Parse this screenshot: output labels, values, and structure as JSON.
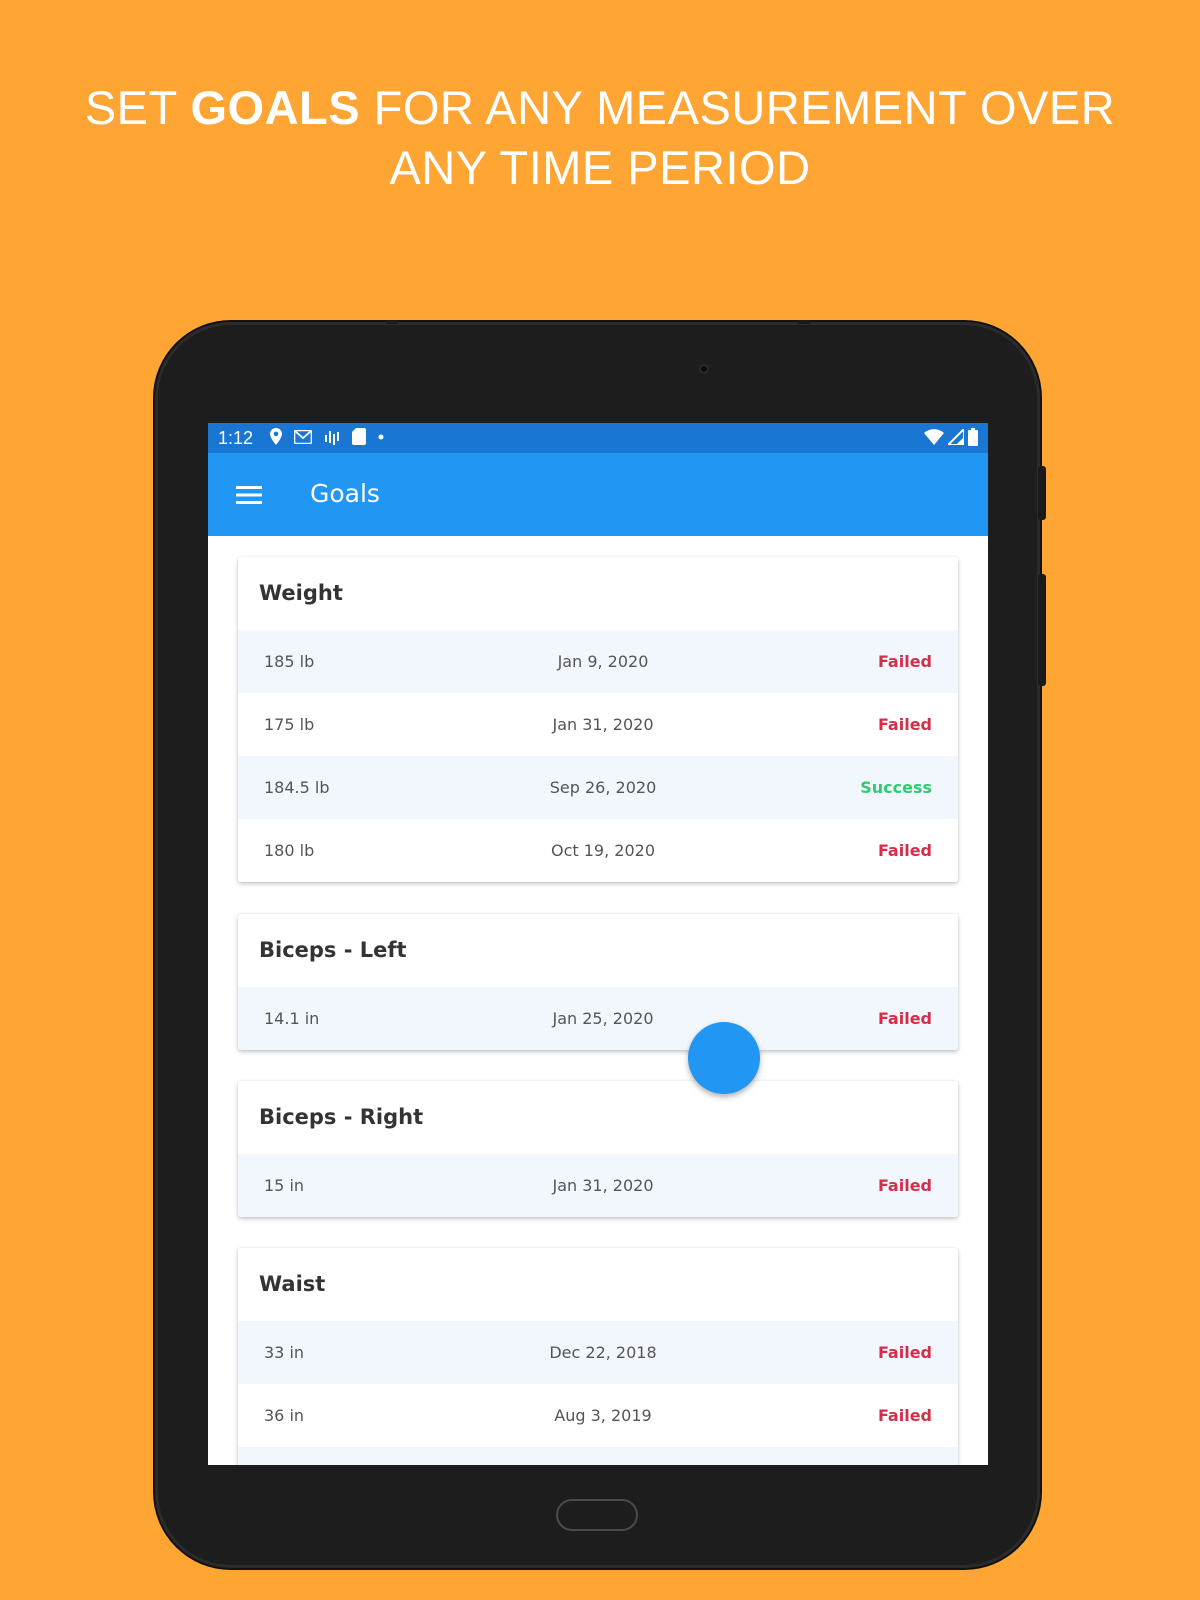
{
  "headline": {
    "line1_prefix": "SET ",
    "line1_bold": "GOALS",
    "line1_suffix": " FOR ANY MEASUREMENT OVER",
    "line2": "ANY TIME PERIOD"
  },
  "status_bar": {
    "time": "1:12",
    "left_icons": [
      "location-icon",
      "gmail-icon",
      "signal-bars-icon",
      "sd-card-icon",
      "dot-icon"
    ],
    "right_icons": [
      "wifi-icon",
      "cell-signal-icon",
      "battery-icon"
    ]
  },
  "app_bar": {
    "title": "Goals",
    "menu_icon": "hamburger-menu-icon"
  },
  "colors": {
    "background": "#FFA533",
    "status_bar": "#1976D2",
    "app_bar": "#2196F3",
    "failed": "#D32F4B",
    "success": "#2ECC71",
    "alt_row": "#F1F7FD"
  },
  "cards": [
    {
      "title": "Weight",
      "rows": [
        {
          "value": "185 lb",
          "date": "Jan 9, 2020",
          "status": "Failed"
        },
        {
          "value": "175 lb",
          "date": "Jan 31, 2020",
          "status": "Failed"
        },
        {
          "value": "184.5 lb",
          "date": "Sep 26, 2020",
          "status": "Success"
        },
        {
          "value": "180 lb",
          "date": "Oct 19, 2020",
          "status": "Failed"
        }
      ]
    },
    {
      "title": "Biceps - Left",
      "rows": [
        {
          "value": "14.1 in",
          "date": "Jan 25, 2020",
          "status": "Failed"
        }
      ]
    },
    {
      "title": "Biceps - Right",
      "rows": [
        {
          "value": "15 in",
          "date": "Jan 31, 2020",
          "status": "Failed"
        }
      ]
    },
    {
      "title": "Waist",
      "rows": [
        {
          "value": "33 in",
          "date": "Dec 22, 2018",
          "status": "Failed"
        },
        {
          "value": "36 in",
          "date": "Aug 3, 2019",
          "status": "Failed"
        }
      ]
    }
  ]
}
